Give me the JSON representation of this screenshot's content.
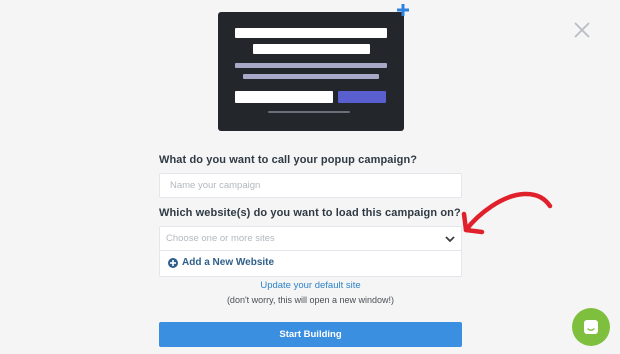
{
  "form": {
    "name_label": "What do you want to call your popup campaign?",
    "name_placeholder": "Name your campaign",
    "sites_label": "Which website(s) do you want to load this campaign on?",
    "sites_placeholder": "Choose one or more sites",
    "add_site_label": "Add a New Website",
    "update_link": "Update your default site",
    "note": "(don't worry, this will open a new window!)",
    "submit_label": "Start Building"
  },
  "colors": {
    "accent": "#3b8fe0",
    "preview_bg": "#23262b",
    "preview_button": "#5a5fd0",
    "arrow": "#e0202a",
    "chat": "#7fbf3e"
  },
  "icons": {
    "close": "close-icon",
    "plus": "plus-icon",
    "chevron": "chevron-down-icon",
    "add": "plus-circle-icon",
    "arrow": "annotation-arrow-icon",
    "chat": "chat-icon"
  }
}
